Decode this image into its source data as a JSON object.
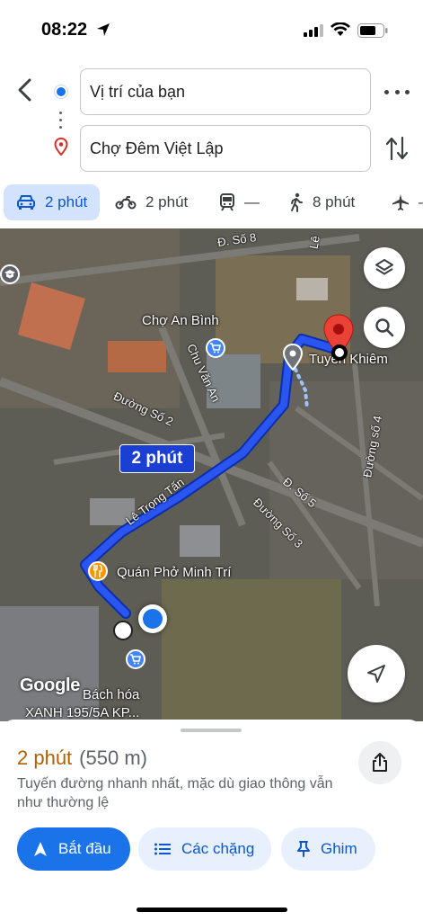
{
  "status": {
    "time": "08:22"
  },
  "route": {
    "origin_value": "Vị trí của bạn",
    "destination_value": "Chợ Đêm Việt Lập"
  },
  "modes": [
    {
      "name": "car",
      "value": "2 phút",
      "active": true
    },
    {
      "name": "motorbike",
      "value": "2 phút"
    },
    {
      "name": "transit",
      "value": "—"
    },
    {
      "name": "walk",
      "value": "8 phút"
    },
    {
      "name": "flight",
      "value": "–"
    }
  ],
  "map": {
    "labels": {
      "cho_an_binh": "Chợ An Bình",
      "tuyen_khiem": "Tuyến Khiêm",
      "quan_pho": "Quán Phở Minh Trí",
      "bach_hoa_line1": "Bách hóa",
      "bach_hoa_line2": "XANH 195/5A KP..."
    },
    "streets": {
      "d_so_8": "Đ. Số 8",
      "chu_van_an": "Chu Văn An",
      "duong_so_2": "Đường Số 2",
      "duong_so_4": "Đường số 4",
      "d_so_5": "Đ. Số 5",
      "duong_so_3": "Đường Số 3",
      "le_trong_tan": "Lê Trọng Tấn",
      "le_partial": "Lê"
    },
    "route_time_label": "2 phút",
    "google_logo": "Google",
    "route_color": "#1a3fd2"
  },
  "sheet": {
    "eta": "2 phút",
    "distance": "(550 m)",
    "description": "Tuyến đường nhanh nhất, mặc dù giao thông vẫn như thường lệ",
    "start_label": "Bắt đầu",
    "steps_label": "Các chặng",
    "pin_label": "Ghim"
  }
}
